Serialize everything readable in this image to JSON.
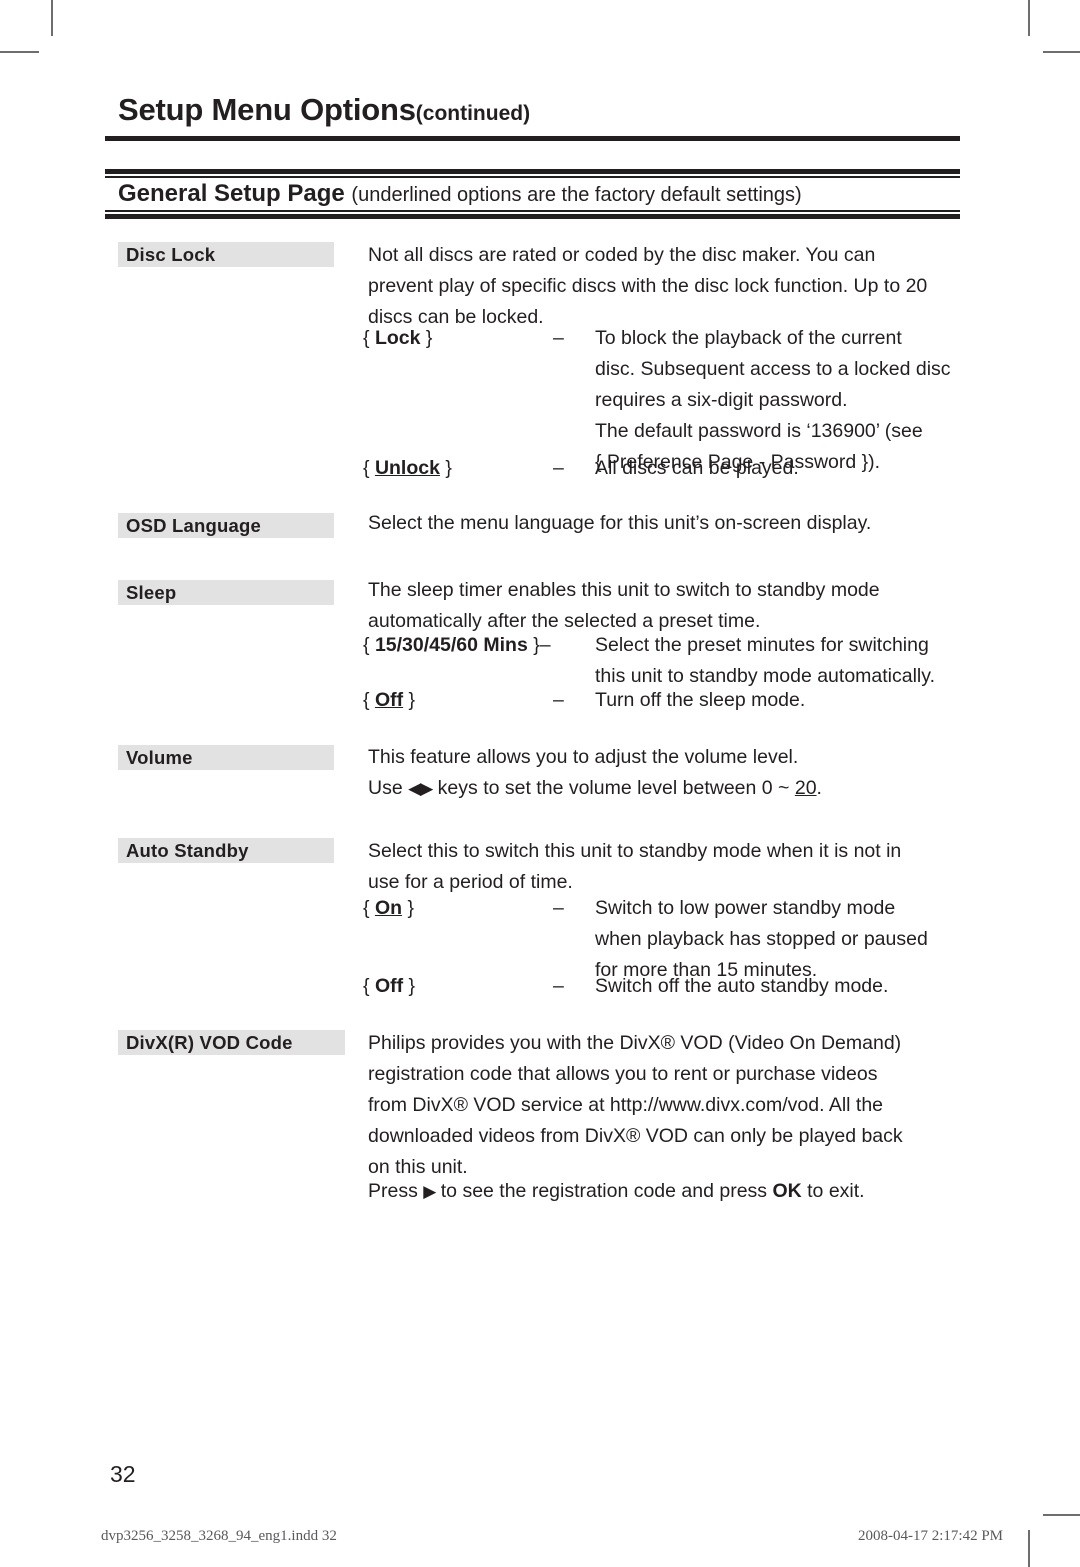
{
  "header": {
    "title": "Setup Menu Options",
    "title_suffix": "(continued)",
    "section_title": "General Setup Page",
    "section_note": "(underlined options are the factory default settings)"
  },
  "entries": [
    {
      "label": "Disc Lock",
      "paragraphs": [
        "Not all discs are rated or coded by the disc maker. You can",
        "prevent play of specific discs with the disc lock function. Up to 20",
        "discs can be locked."
      ],
      "options": [
        {
          "open": "{",
          "name": "Lock",
          "close": "}",
          "underline": false,
          "dash": "–",
          "desc": [
            "To block the playback of the current",
            "disc. Subsequent access to a locked disc",
            "requires a six-digit password.",
            "The default password is ‘136900’ (see",
            "{ Preference Page - Password })."
          ]
        },
        {
          "open": "{",
          "name": "Unlock",
          "close": "}",
          "underline": true,
          "dash": "–",
          "desc": [
            "All discs can be played."
          ]
        }
      ]
    },
    {
      "label": "OSD Language",
      "paragraphs": [
        "Select the menu language for this unit’s on-screen display."
      ],
      "options": []
    },
    {
      "label": "Sleep",
      "paragraphs": [
        "The sleep timer enables this unit to switch to standby mode",
        "automatically after the selected a preset time."
      ],
      "options": [
        {
          "open": "{",
          "name": "15/30/45/60 Mins",
          "close": "}–",
          "underline": false,
          "dash": "",
          "desc": [
            "Select the preset minutes for switching",
            "this unit to standby mode automatically."
          ]
        },
        {
          "open": "{",
          "name": "Off",
          "close": "}",
          "underline": true,
          "dash": "–",
          "desc": [
            "Turn off the sleep mode."
          ]
        }
      ]
    },
    {
      "label": "Volume",
      "paragraphs": [
        "This feature allows you to adjust the volume level."
      ],
      "volume_line": {
        "prefix": "Use ",
        "left_arrow": "◀",
        "right_arrow": "▶",
        "mid": " keys to set the volume level between 0 ~ ",
        "default_value": "20",
        "suffix": "."
      },
      "options": []
    },
    {
      "label": "Auto Standby",
      "paragraphs": [
        "Select this to switch this unit to standby mode when it is not in",
        "use for a period of time."
      ],
      "options": [
        {
          "open": "{",
          "name": "On",
          "close": "}",
          "underline": true,
          "dash": "–",
          "desc": [
            "Switch to low power standby mode",
            "when playback has stopped or paused",
            "for more than 15 minutes."
          ]
        },
        {
          "open": "{",
          "name": "Off",
          "close": "}",
          "underline": false,
          "dash": "–",
          "desc": [
            "Switch off the auto standby mode."
          ]
        }
      ]
    },
    {
      "label": "DivX(R) VOD Code",
      "paragraphs": [
        "Philips provides you with the DivX® VOD (Video On Demand)",
        "registration code that allows you to rent or purchase videos",
        "from DivX® VOD service at http://www.divx.com/vod. All the",
        "downloaded videos from DivX® VOD can only be played back",
        "on this unit."
      ],
      "press_line": {
        "prefix": "Press ",
        "arrow": "▶",
        "mid": " to see the registration code and press ",
        "ok": "OK",
        "suffix": " to exit."
      },
      "options": []
    }
  ],
  "footer": {
    "page_number": "32",
    "file_name": "dvp3256_3258_3268_94_eng1.indd   32",
    "timestamp": "2008-04-17   2:17:42 PM"
  },
  "colors": {
    "ink": "#231f20",
    "label_background": "#e2e2e2",
    "crop_mark": "#6d6e71"
  }
}
